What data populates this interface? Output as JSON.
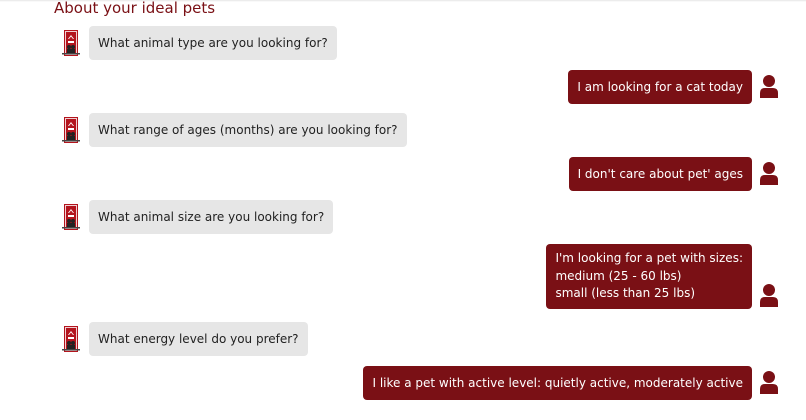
{
  "header": {
    "title": "About your ideal pets"
  },
  "colors": {
    "accent": "#7a1015",
    "bot_bubble": "#e6e6e6"
  },
  "icons": {
    "bot": "pet-shelter-logo-icon",
    "user": "user-icon"
  },
  "messages": [
    {
      "sender": "bot",
      "text": "What animal type are you looking for?"
    },
    {
      "sender": "user",
      "text": "I am looking for a cat today"
    },
    {
      "sender": "bot",
      "text": "What range of ages (months) are you looking for?"
    },
    {
      "sender": "user",
      "text": "I don't care about pet' ages"
    },
    {
      "sender": "bot",
      "text": "What animal size are you looking for?"
    },
    {
      "sender": "user",
      "lines": [
        "I'm looking for a pet with sizes:",
        "medium (25 - 60 lbs)",
        "small (less than 25 lbs)"
      ]
    },
    {
      "sender": "bot",
      "text": "What energy level do you prefer?"
    },
    {
      "sender": "user",
      "text": "I like a pet with active level: quietly active, moderately active"
    }
  ]
}
